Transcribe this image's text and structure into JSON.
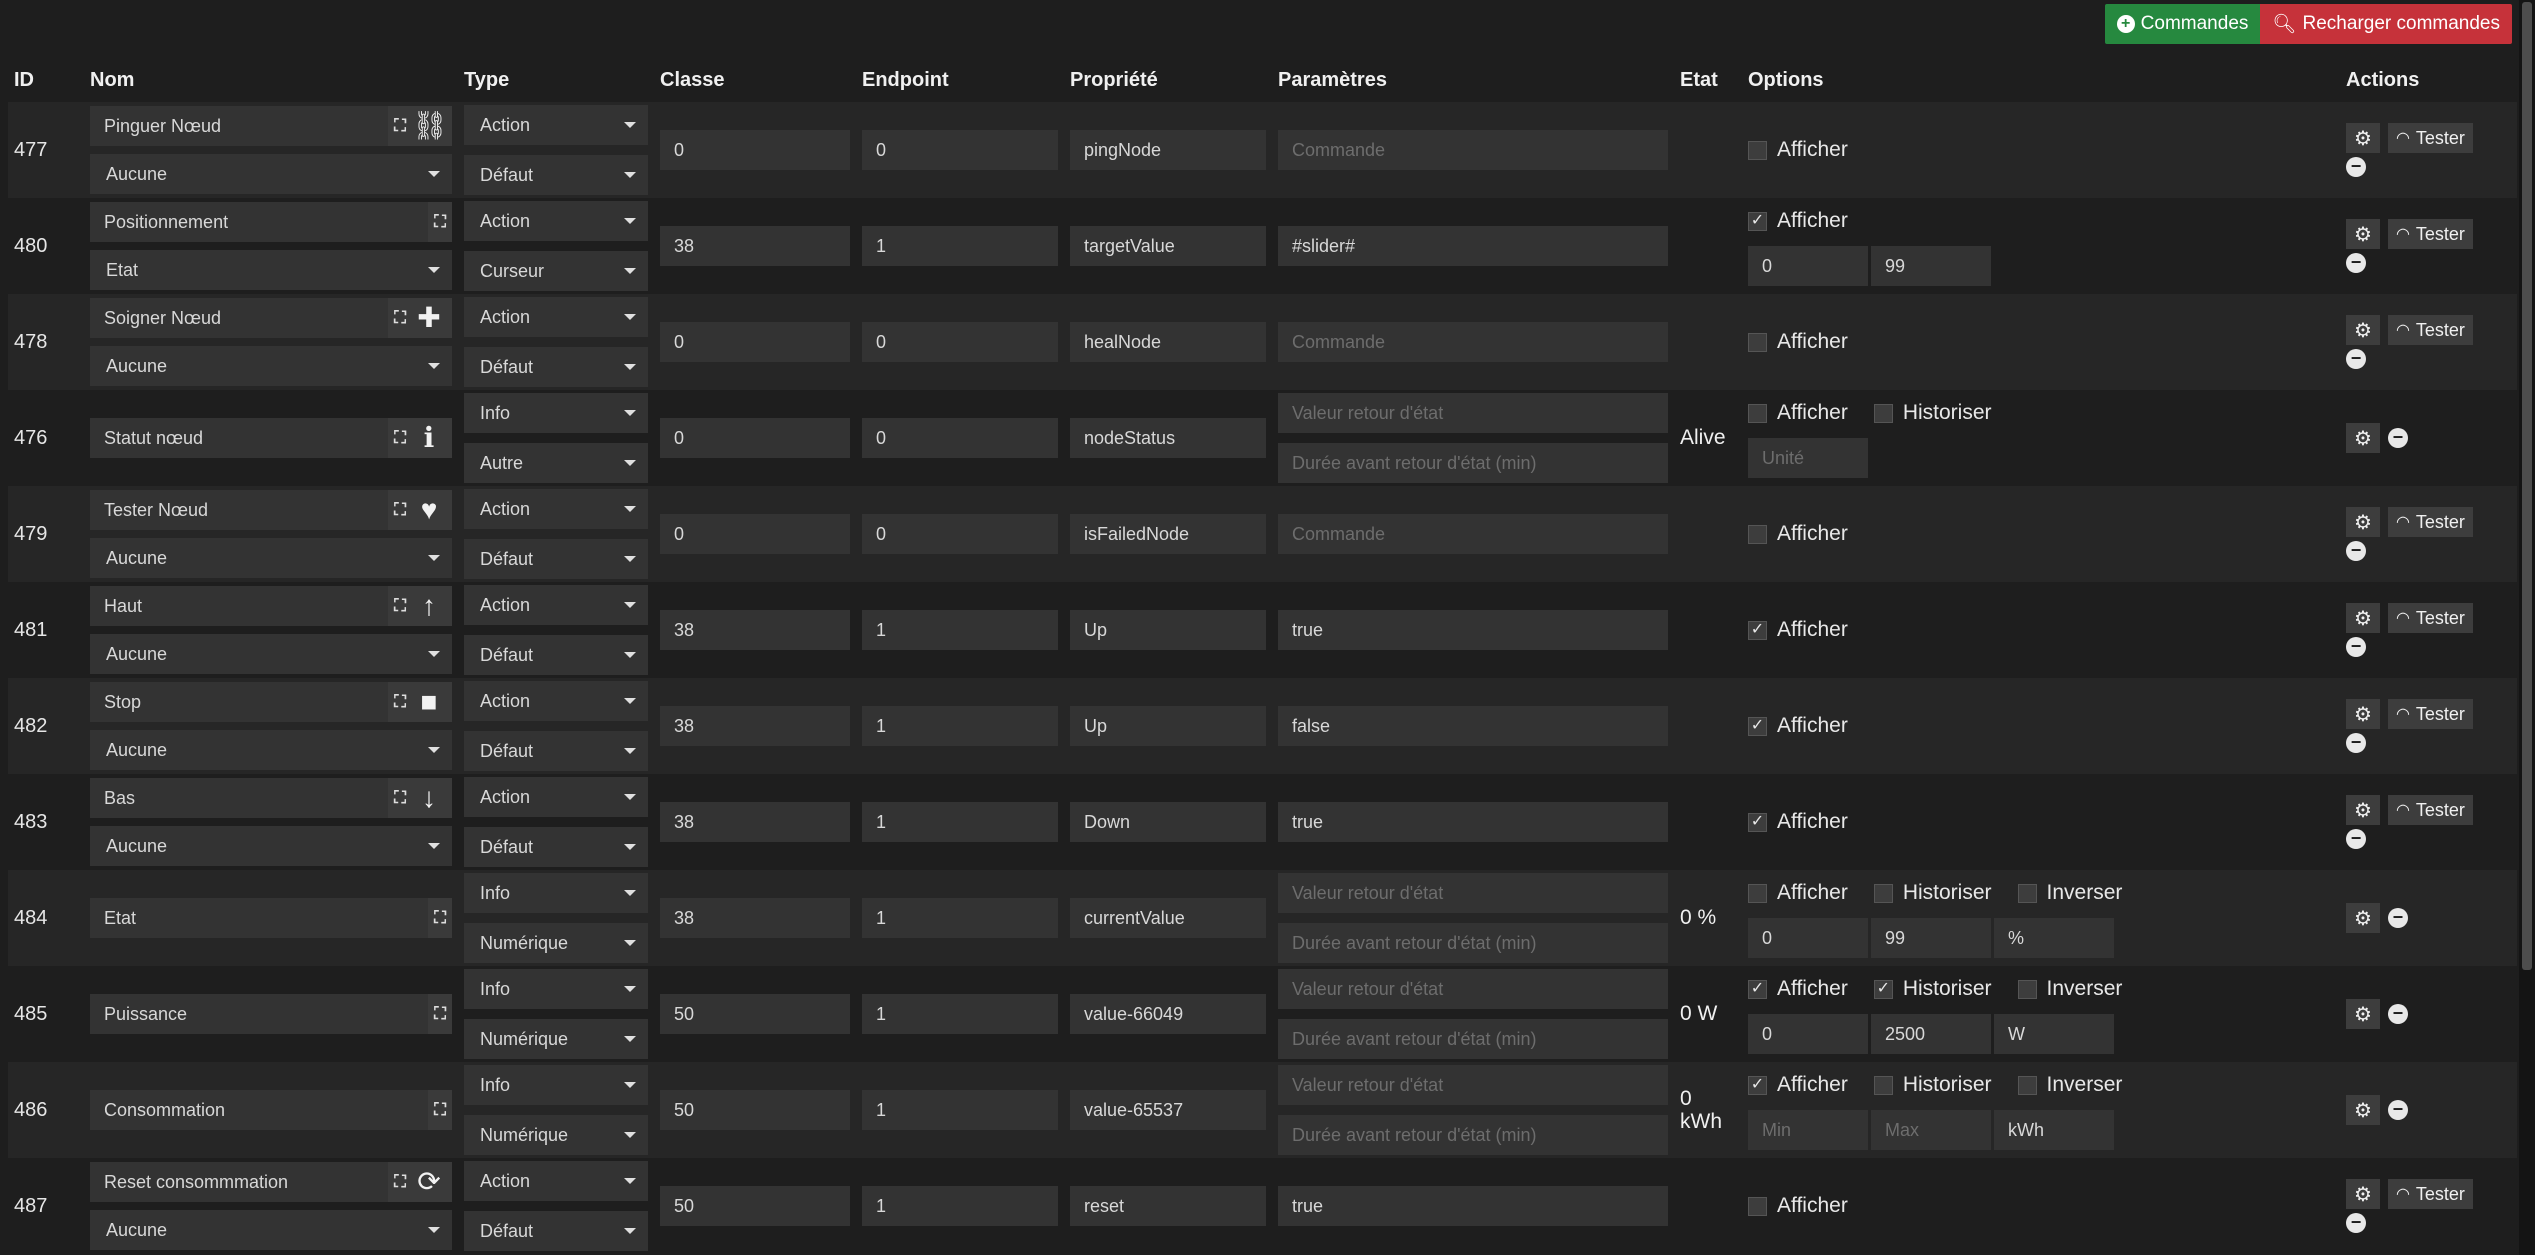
{
  "toolbar": {
    "commands_label": "Commandes",
    "reload_label": "Recharger commandes"
  },
  "headers": {
    "id": "ID",
    "nom": "Nom",
    "type": "Type",
    "classe": "Classe",
    "endpoint": "Endpoint",
    "propriete": "Propriété",
    "parametres": "Paramètres",
    "etat": "Etat",
    "options": "Options",
    "actions": "Actions"
  },
  "labels": {
    "afficher": "Afficher",
    "historiser": "Historiser",
    "inverser": "Inverser",
    "tester": "Tester"
  },
  "placeholders": {
    "commande": "Commande",
    "valeur_retour": "Valeur retour d'état",
    "duree_retour": "Durée avant retour d'état (min)",
    "unite": "Unité",
    "min": "Min",
    "max": "Max"
  },
  "rows": [
    {
      "id": "477",
      "name": "Pinguer Nœud",
      "icon": "sitemap-icon",
      "sub": "Aucune",
      "type": "Action",
      "subtype": "Défaut",
      "classe": "0",
      "endpoint": "0",
      "prop": "pingNode",
      "param": "",
      "afficher": false
    },
    {
      "id": "480",
      "name": "Positionnement",
      "icon": "",
      "sub": "Etat",
      "type": "Action",
      "subtype": "Curseur",
      "classe": "38",
      "endpoint": "1",
      "prop": "targetValue",
      "param": "#slider#",
      "afficher": true,
      "min": "0",
      "max": "99"
    },
    {
      "id": "478",
      "name": "Soigner Nœud",
      "icon": "medkit-icon",
      "sub": "Aucune",
      "type": "Action",
      "subtype": "Défaut",
      "classe": "0",
      "endpoint": "0",
      "prop": "healNode",
      "param": "",
      "afficher": false
    },
    {
      "id": "476",
      "name": "Statut nœud",
      "icon": "info-icon",
      "type": "Info",
      "subtype": "Autre",
      "classe": "0",
      "endpoint": "0",
      "prop": "nodeStatus",
      "etat": "Alive",
      "afficher": false,
      "historiser": false
    },
    {
      "id": "479",
      "name": "Tester Nœud",
      "icon": "heartbeat-icon",
      "sub": "Aucune",
      "type": "Action",
      "subtype": "Défaut",
      "classe": "0",
      "endpoint": "0",
      "prop": "isFailedNode",
      "param": "",
      "afficher": false
    },
    {
      "id": "481",
      "name": "Haut",
      "icon": "arrow-up-icon",
      "sub": "Aucune",
      "type": "Action",
      "subtype": "Défaut",
      "classe": "38",
      "endpoint": "1",
      "prop": "Up",
      "param": "true",
      "afficher": true
    },
    {
      "id": "482",
      "name": "Stop",
      "icon": "stop-icon",
      "sub": "Aucune",
      "type": "Action",
      "subtype": "Défaut",
      "classe": "38",
      "endpoint": "1",
      "prop": "Up",
      "param": "false",
      "afficher": true
    },
    {
      "id": "483",
      "name": "Bas",
      "icon": "arrow-down-icon",
      "sub": "Aucune",
      "type": "Action",
      "subtype": "Défaut",
      "classe": "38",
      "endpoint": "1",
      "prop": "Down",
      "param": "true",
      "afficher": true
    },
    {
      "id": "484",
      "name": "Etat",
      "icon": "",
      "type": "Info",
      "subtype": "Numérique",
      "classe": "38",
      "endpoint": "1",
      "prop": "currentValue",
      "etat": "0 %",
      "afficher": false,
      "historiser": false,
      "inverser": false,
      "min": "0",
      "max": "99",
      "unit": "%"
    },
    {
      "id": "485",
      "name": "Puissance",
      "icon": "",
      "type": "Info",
      "subtype": "Numérique",
      "classe": "50",
      "endpoint": "1",
      "prop": "value-66049",
      "etat": "0 W",
      "afficher": true,
      "historiser": true,
      "inverser": false,
      "min": "0",
      "max": "2500",
      "unit": "W"
    },
    {
      "id": "486",
      "name": "Consommation",
      "icon": "",
      "type": "Info",
      "subtype": "Numérique",
      "classe": "50",
      "endpoint": "1",
      "prop": "value-65537",
      "etat": "0 kWh",
      "afficher": true,
      "historiser": false,
      "inverser": false,
      "min": "",
      "max": "",
      "unit": "kWh"
    },
    {
      "id": "487",
      "name": "Reset consommmation",
      "icon": "refresh-icon",
      "sub": "Aucune",
      "type": "Action",
      "subtype": "Défaut",
      "classe": "50",
      "endpoint": "1",
      "prop": "reset",
      "param": "true",
      "afficher": false
    }
  ]
}
